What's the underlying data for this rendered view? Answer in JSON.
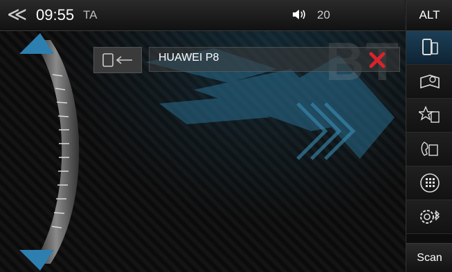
{
  "status_bar": {
    "back_glyph": "≪",
    "time": "09:55",
    "ta_label": "TA",
    "volume_icon": "speaker-icon",
    "volume": "20"
  },
  "right_bar": {
    "alt_label": "ALT",
    "buttons": [
      {
        "name": "phone-device-icon",
        "active": true
      },
      {
        "name": "phonebook-icon",
        "active": false
      },
      {
        "name": "favorites-icon",
        "active": false
      },
      {
        "name": "call-log-icon",
        "active": false
      },
      {
        "name": "dialpad-icon",
        "active": false
      },
      {
        "name": "bluetooth-settings-icon",
        "active": false
      }
    ],
    "scan_label": "Scan"
  },
  "device_list": {
    "watermark": "BT",
    "devices": [
      {
        "name": "HUAWEI P8"
      }
    ]
  },
  "colors": {
    "accent": "#2d7fb0",
    "delete": "#d9222a"
  }
}
